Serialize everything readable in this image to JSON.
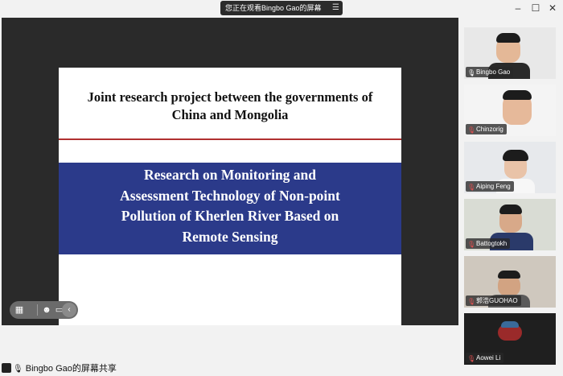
{
  "titlebar": {
    "share_notice": "您正在观看Bingbo Gao的屏幕",
    "menu_icon": "list-menu-icon",
    "minimize_icon": "minimize-icon",
    "maximize_icon": "maximize-icon",
    "close_icon": "close-icon"
  },
  "slide": {
    "title_line1": "Joint research project between the governments of",
    "title_line2": "China and Mongolia",
    "band_line1": "Research on Monitoring and",
    "band_line2": "Assessment Technology of Non-point",
    "band_line3": "Pollution of Kherlen River Based on",
    "band_line4": "Remote Sensing",
    "band_color": "#2b3a8a",
    "rule_color": "#b03030"
  },
  "toolbar": {
    "icons": [
      "grid-layout-icon",
      "emoji-icon",
      "annotate-icon",
      "chevron-left-icon"
    ]
  },
  "footer": {
    "label": "Bingbo Gao的屏幕共享"
  },
  "participants": [
    {
      "name": "Bingbo Gao",
      "mic": "on"
    },
    {
      "name": "Chinzorig",
      "mic": "muted"
    },
    {
      "name": "Aiping Feng",
      "mic": "muted"
    },
    {
      "name": "Battogtokh",
      "mic": "muted"
    },
    {
      "name": "郭浩GUOHAO",
      "mic": "muted"
    },
    {
      "name": "Aowei Li",
      "mic": "muted"
    }
  ]
}
